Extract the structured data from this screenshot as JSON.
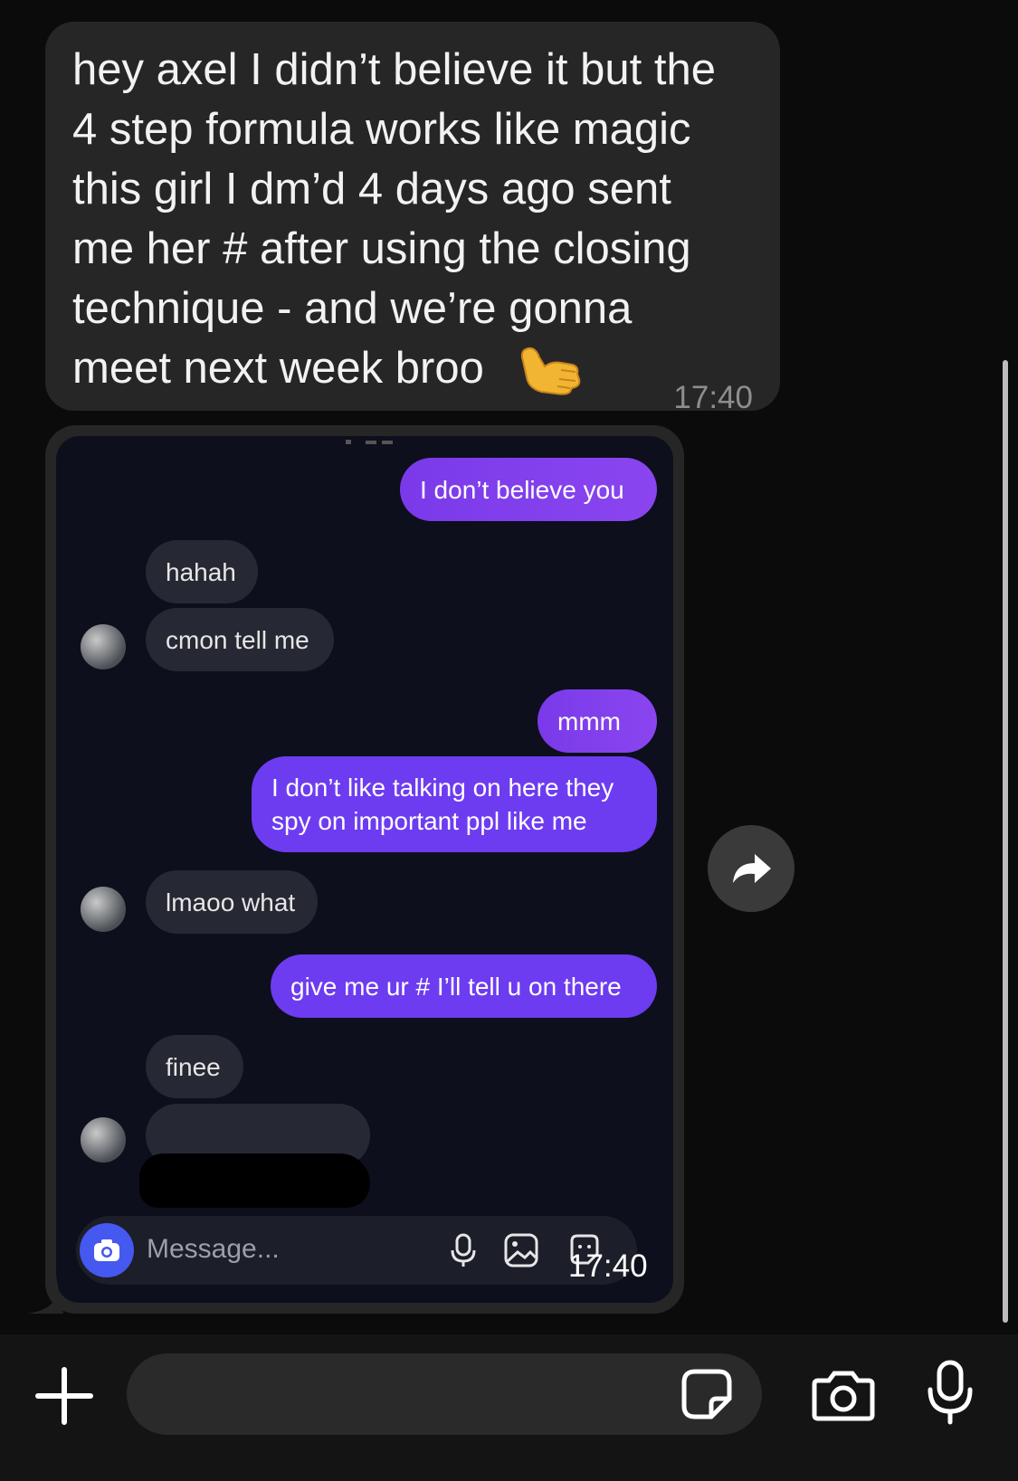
{
  "message": {
    "text": "hey axel I didn’t believe it but the\n4 step formula works like magic\nthis girl I dm’d 4 days ago sent\nme her # after using the closing\ntechnique - and we’re gonna\nmeet next week broo",
    "emoji": "call-me-hand",
    "time": "17:40"
  },
  "screenshot": {
    "messages": [
      {
        "side": "out",
        "text": "I don’t believe you"
      },
      {
        "side": "in",
        "text": "hahah"
      },
      {
        "side": "in",
        "text": "cmon tell me"
      },
      {
        "side": "out",
        "text": "mmm"
      },
      {
        "side": "out",
        "text": "I don’t like talking on here they\nspy on important ppl like me"
      },
      {
        "side": "in",
        "text": "lmaoo what"
      },
      {
        "side": "out",
        "text": "give me ur # I’ll tell u on there"
      },
      {
        "side": "in",
        "text": "finee"
      }
    ],
    "input_placeholder": "Message...",
    "time": "17:40"
  },
  "composer": {
    "placeholder": ""
  },
  "colors": {
    "outgoing": "#8a45f0",
    "incoming": "#262833",
    "bubble": "#262626",
    "accent": "#4558f0"
  }
}
